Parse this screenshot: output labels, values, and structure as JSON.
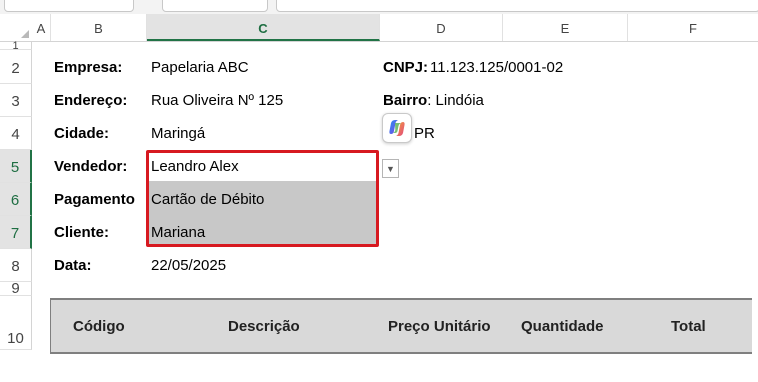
{
  "columns": [
    "A",
    "B",
    "C",
    "D",
    "E",
    "F"
  ],
  "rows": [
    "1",
    "2",
    "3",
    "4",
    "5",
    "6",
    "7",
    "8",
    "9",
    "10"
  ],
  "company": {
    "empresa_label": "Empresa:",
    "empresa_value": "Papelaria ABC",
    "cnpj_label": "CNPJ:",
    "cnpj_value": "11.123.125/0001-02",
    "endereco_label": "Endereço:",
    "endereco_value": "Rua Oliveira Nº 125",
    "bairro_label": "Bairro",
    "bairro_value": ": Lindóia",
    "cidade_label": "Cidade:",
    "cidade_value": "Maringá",
    "uf_partial": "PR"
  },
  "sale": {
    "vendedor_label": "Vendedor:",
    "vendedor_value": "Leandro Alex",
    "pagamento_label": "Pagamento",
    "pagamento_value": "Cartão de Débito",
    "cliente_label": "Cliente:",
    "cliente_value": "Mariana",
    "data_label": "Data:",
    "data_value": "22/05/2025"
  },
  "table_headers": [
    "Código",
    "Descrição",
    "Preço Unitário",
    "Quantidade",
    "Total"
  ],
  "colors": {
    "selection_border": "#d71920",
    "excel_green": "#217346",
    "header_fill": "#d9d9d9"
  },
  "icons": [
    "copilot-icon",
    "dropdown-arrow-icon"
  ]
}
